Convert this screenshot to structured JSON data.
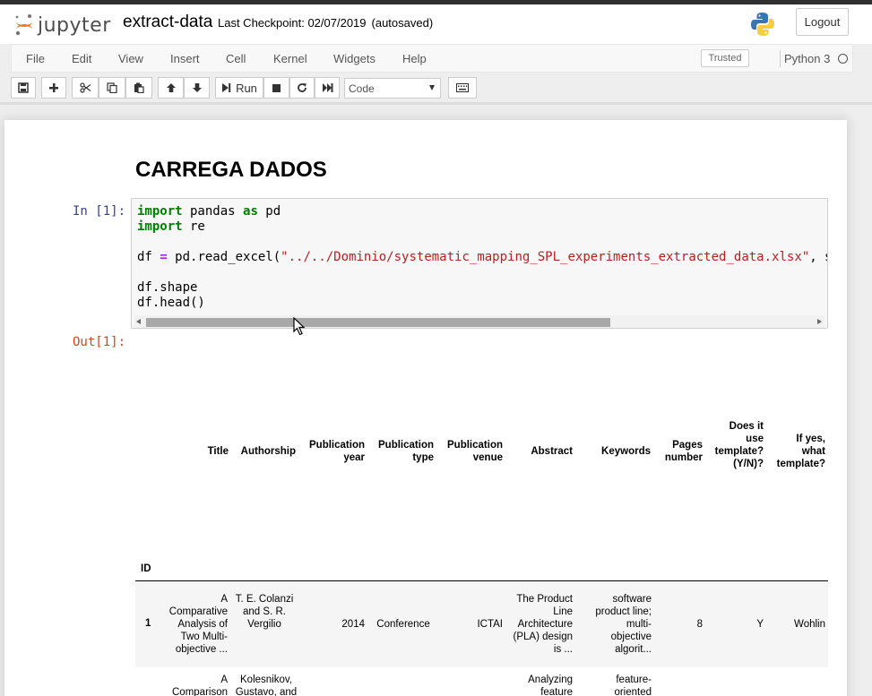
{
  "header": {
    "logo_text": "jupyter",
    "notebook_name": "extract-data",
    "checkpoint": "Last Checkpoint: 02/07/2019",
    "autosaved": "(autosaved)",
    "logout_label": "Logout"
  },
  "menu": {
    "items": [
      "File",
      "Edit",
      "View",
      "Insert",
      "Cell",
      "Kernel",
      "Widgets",
      "Help"
    ],
    "trusted_label": "Trusted",
    "kernel_name": "Python 3"
  },
  "toolbar": {
    "run_label": "Run",
    "cell_type": "Code"
  },
  "notebook": {
    "heading": "CARREGA DADOS",
    "in_prompt": "In [1]:",
    "out_prompt": "Out[1]:",
    "code": {
      "line1_kw1": "import",
      "line1_mid": " pandas ",
      "line1_kw2": "as",
      "line1_end": " pd",
      "line2_kw": "import",
      "line2_end": " re",
      "line4_start": "df ",
      "line4_op": "=",
      "line4_mid": " pd.read_excel(",
      "line4_str": "\"../../Dominio/systematic_mapping_SPL_experiments_extracted_data.xlsx\"",
      "line4_end": ", s",
      "line6": "df.shape",
      "line7": "df.head()"
    }
  },
  "dataframe": {
    "index_name": "ID",
    "columns": [
      "Title",
      "Authorship",
      "Publication year",
      "Publication type",
      "Publication venue",
      "Abstract",
      "Keywords",
      "Pages number",
      "Does it use template? (Y/N)?",
      "If yes, what template?"
    ],
    "rows": [
      {
        "id": "1",
        "cells": [
          "A Comparative Analysis of Two Multi-objective ...",
          "T. E. Colanzi and S. R. Vergilio",
          "2014",
          "Conference",
          "ICTAI",
          "The Product Line Architecture (PLA) design is ...",
          "software product line; multi-objective algorit...",
          "8",
          "Y",
          "Wohlin"
        ]
      },
      {
        "id": "",
        "cells": [
          "A Comparison",
          "Kolesnikov, Gustavo, and",
          "",
          "",
          "",
          "Analyzing feature",
          "feature-oriented",
          "",
          "",
          ""
        ]
      }
    ]
  }
}
